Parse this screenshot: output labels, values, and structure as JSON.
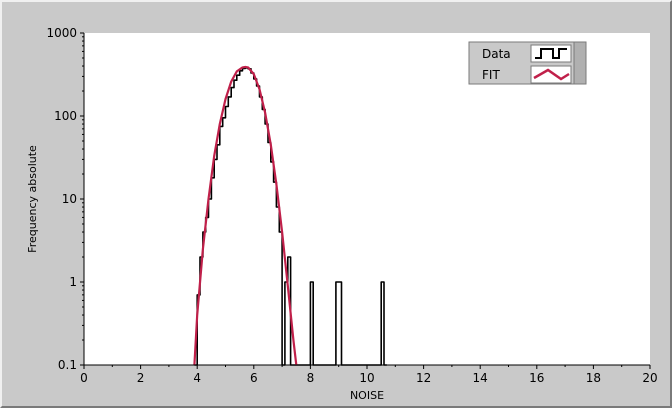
{
  "chart_data": {
    "type": "line",
    "title": "",
    "xlabel": "NOISE",
    "ylabel": "Frequency absolute",
    "xlim": [
      0,
      20
    ],
    "ylim": [
      0.1,
      1000
    ],
    "yscale": "log",
    "grid": false,
    "legend_position": "top-right",
    "x_ticks": [
      "0",
      "2",
      "4",
      "6",
      "8",
      "10",
      "12",
      "14",
      "16",
      "18",
      "20"
    ],
    "y_ticks": [
      "0.1",
      "1",
      "10",
      "100",
      "1000"
    ],
    "series": [
      {
        "name": "Data",
        "style": "step",
        "color": "#000000",
        "x": [
          3.9,
          4.0,
          4.1,
          4.2,
          4.3,
          4.4,
          4.5,
          4.6,
          4.7,
          4.8,
          4.9,
          5.0,
          5.1,
          5.2,
          5.3,
          5.4,
          5.5,
          5.6,
          5.7,
          5.8,
          5.9,
          6.0,
          6.1,
          6.2,
          6.3,
          6.4,
          6.5,
          6.6,
          6.7,
          6.8,
          6.9,
          7.0,
          7.1,
          7.2,
          7.3,
          7.4,
          7.5,
          7.6,
          7.7,
          7.8,
          7.9,
          8.0,
          8.1,
          8.2,
          8.3,
          8.4,
          8.5,
          8.6,
          8.7,
          8.8,
          8.9,
          9.0,
          9.1,
          9.2,
          9.3,
          9.4,
          9.5,
          9.6,
          9.7,
          9.8,
          9.9,
          10.0,
          10.1,
          10.2,
          10.3,
          10.4,
          10.5,
          10.6
        ],
        "values": [
          0.1,
          0.7,
          2,
          4,
          6,
          10,
          18,
          30,
          45,
          75,
          95,
          130,
          170,
          220,
          270,
          310,
          350,
          375,
          380,
          370,
          330,
          280,
          230,
          170,
          120,
          80,
          48,
          28,
          16,
          8,
          4,
          0.1,
          1,
          2,
          0.1,
          0.1,
          0.1,
          0.1,
          0.1,
          0.1,
          0.1,
          1,
          0.1,
          0.1,
          0.1,
          0.1,
          0.1,
          0.1,
          0.1,
          0.1,
          1,
          1,
          0.1,
          0.1,
          0.1,
          0.1,
          0.1,
          0.1,
          0.1,
          0.1,
          0.1,
          0.1,
          0.1,
          0.1,
          0.1,
          0.1,
          1,
          0.1
        ]
      },
      {
        "name": "FIT",
        "style": "line",
        "color": "#c0204a",
        "x": [
          3.9,
          4.0,
          4.2,
          4.4,
          4.6,
          4.8,
          5.0,
          5.2,
          5.4,
          5.6,
          5.7,
          5.8,
          6.0,
          6.2,
          6.4,
          6.6,
          6.8,
          7.0,
          7.2,
          7.4,
          7.5
        ],
        "values": [
          0.1,
          0.4,
          2.5,
          10,
          33,
          80,
          160,
          260,
          345,
          385,
          390,
          385,
          320,
          210,
          110,
          45,
          15,
          4,
          0.9,
          0.2,
          0.1
        ]
      }
    ]
  },
  "legend": {
    "items": [
      {
        "label": "Data"
      },
      {
        "label": "FIT"
      }
    ]
  }
}
